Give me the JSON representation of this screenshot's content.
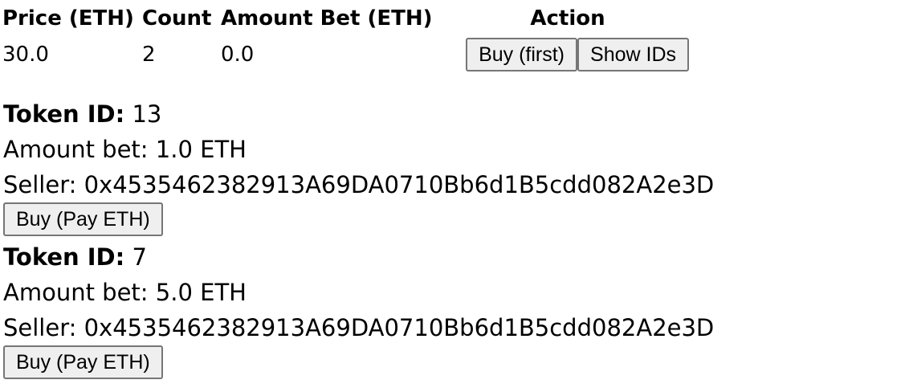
{
  "table": {
    "headers": {
      "price": "Price (ETH)",
      "count": "Count",
      "amount": "Amount Bet (ETH)",
      "action": "Action"
    },
    "rows": [
      {
        "price": "30.0",
        "count": "2",
        "amount": "0.0",
        "buy_first_label": "Buy (first)",
        "show_ids_label": "Show IDs"
      }
    ]
  },
  "tokens": [
    {
      "token_id_label": "Token ID:",
      "token_id": "13",
      "amount_bet": "Amount bet: 1.0 ETH",
      "seller": "Seller: 0x4535462382913A69DA0710Bb6d1B5cdd082A2e3D",
      "buy_label": "Buy (Pay ETH)"
    },
    {
      "token_id_label": "Token ID:",
      "token_id": "7",
      "amount_bet": "Amount bet: 5.0 ETH",
      "seller": "Seller: 0x4535462382913A69DA0710Bb6d1B5cdd082A2e3D",
      "buy_label": "Buy (Pay ETH)"
    }
  ]
}
